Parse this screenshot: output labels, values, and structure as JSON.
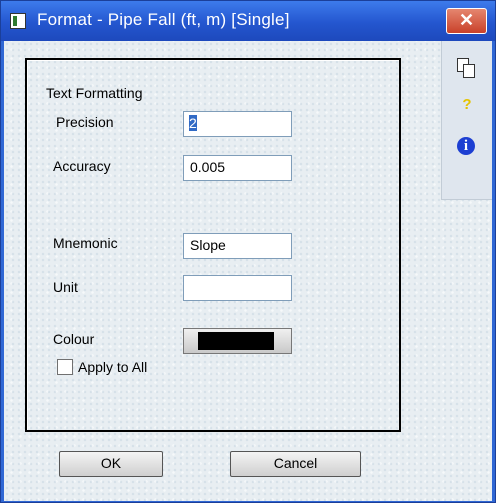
{
  "window": {
    "title": "Format - Pipe Fall (ft, m) [Single]",
    "close_glyph": "✕"
  },
  "group": {
    "title": "Text Formatting"
  },
  "fields": {
    "precision": {
      "label": "Precision",
      "value": "2"
    },
    "accuracy": {
      "label": "Accuracy",
      "value": "0.005"
    },
    "mnemonic": {
      "label": "Mnemonic",
      "value": "Slope"
    },
    "unit": {
      "label": "Unit",
      "value": ""
    },
    "colour": {
      "label": "Colour",
      "value_color": "#000000"
    }
  },
  "apply_to_all": {
    "label": "Apply to All",
    "checked": false
  },
  "buttons": {
    "ok": "OK",
    "cancel": "Cancel"
  },
  "sidebar": {
    "icons": [
      "copy-icon",
      "help-icon",
      "info-icon"
    ],
    "help_glyph": "?",
    "info_glyph": "i"
  },
  "colors": {
    "titlebar": "#2456cf",
    "accent": "#316ac5"
  }
}
